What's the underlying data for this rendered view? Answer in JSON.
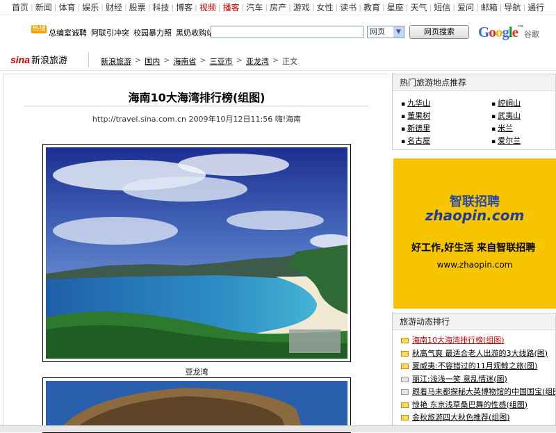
{
  "topnav": [
    {
      "label": "首页"
    },
    {
      "label": "新闻"
    },
    {
      "label": "体育"
    },
    {
      "label": "娱乐"
    },
    {
      "label": "财经"
    },
    {
      "label": "股票"
    },
    {
      "label": "科技"
    },
    {
      "label": "博客"
    },
    {
      "label": "视频",
      "red": true
    },
    {
      "label": "播客",
      "red": true
    },
    {
      "label": "汽车"
    },
    {
      "label": "房产"
    },
    {
      "label": "游戏"
    },
    {
      "label": "女性"
    },
    {
      "label": "读书"
    },
    {
      "label": "教育"
    },
    {
      "label": "星座"
    },
    {
      "label": "天气"
    },
    {
      "label": "短信"
    },
    {
      "label": "爱问"
    },
    {
      "label": "邮箱"
    },
    {
      "label": "导航"
    },
    {
      "label": "通行"
    }
  ],
  "hotbar": {
    "badge": "热搜",
    "links": [
      "总编室诚聘",
      "阿联引冲突",
      "校园暴力照",
      "黑奶收购站"
    ]
  },
  "search": {
    "query": "",
    "scope": "网页",
    "button": "网页搜索",
    "google": "Google",
    "google_cn": "谷歌"
  },
  "brand": {
    "sina": "sina",
    "travel": "新浪旅游"
  },
  "breadcrumb": [
    "新浪旅游",
    "国内",
    "海南省",
    "三亚市",
    "亚龙湾",
    "正文"
  ],
  "article": {
    "title": "海南10大海湾排行榜(组图)",
    "url": "http://travel.sina.com.cn",
    "date": "2009年10月12日11:56",
    "source": "嗨!海南",
    "caption": "亚龙湾"
  },
  "hot_places": {
    "heading": "热门旅游地点推荐",
    "items": [
      "九华山",
      "崆峒山",
      "董果树",
      "武夷山",
      "新德里",
      "米兰",
      "名古屋",
      "爱尔兰"
    ]
  },
  "ad": {
    "brand": "智联招聘",
    "brand_url_big": "zhaopin.com",
    "slogan": "好工作,好生活 来自智联招聘",
    "url": "www.zhaopin.com"
  },
  "ranking": {
    "heading": "旅游动态排行",
    "items": [
      {
        "text": "海南10大海湾排行榜(组图)",
        "color": "#cc0000",
        "icon": "photo"
      },
      {
        "text": "秋高气爽 最适合老人出游的3大线路(图)",
        "color": "#000000",
        "icon": "photo"
      },
      {
        "text": "夏威夷:不容错过的11月观鲸之旅(图)",
        "color": "#000000",
        "icon": "photo"
      },
      {
        "text": "丽江:浅浅一笑 意乱情迷(图)",
        "color": "#000000",
        "icon": "doc"
      },
      {
        "text": "跟着马未都探秘大英博物馆的中国国宝(组图)",
        "color": "#000000",
        "icon": "doc"
      },
      {
        "text": "惊艳 东京浅草桑巴舞的性感(组图)",
        "color": "#000000",
        "icon": "photo"
      },
      {
        "text": "金秋旅游四大秋色推荐(组图)",
        "color": "#000000",
        "icon": "photo"
      }
    ]
  }
}
